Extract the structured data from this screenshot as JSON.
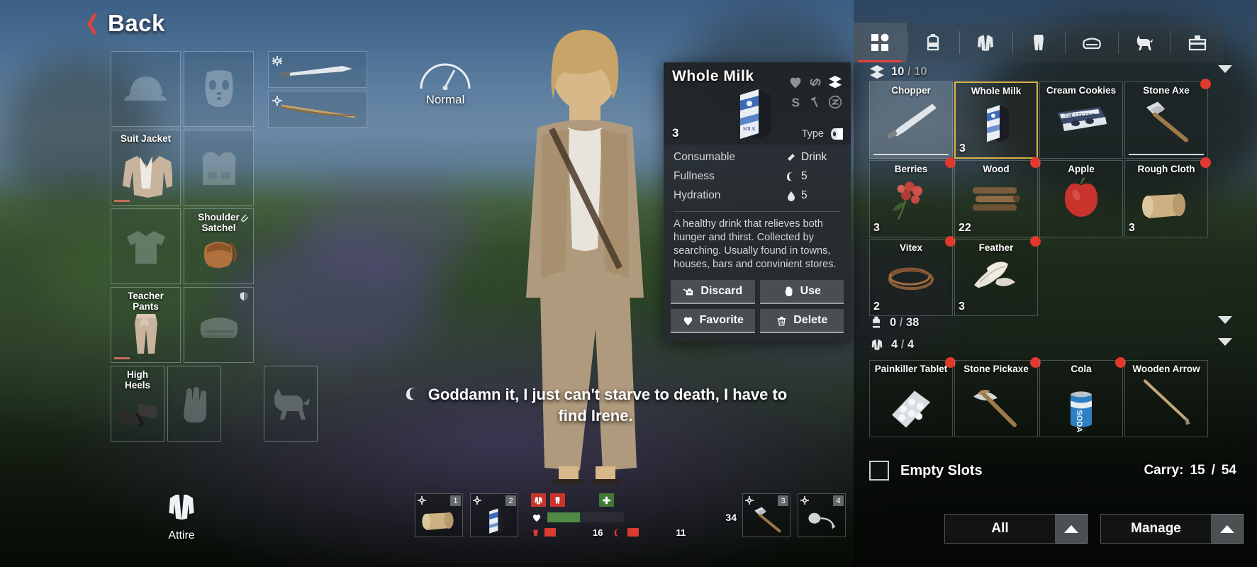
{
  "nav": {
    "back_label": "Back",
    "back_icon": "chevron-left-icon"
  },
  "status": {
    "label": "Normal",
    "icon": "gauge-icon"
  },
  "equipment": {
    "title": "Attire",
    "slots": [
      {
        "name": "",
        "icon": "cap-icon",
        "empty": true,
        "durability": null,
        "badge": null
      },
      {
        "name": "",
        "icon": "mask-icon",
        "empty": true,
        "durability": null,
        "badge": null
      },
      {
        "name": "Suit Jacket",
        "icon": "jacket-icon",
        "empty": false,
        "durability": 30,
        "badge": null
      },
      {
        "name": "",
        "icon": "vest-icon",
        "empty": true,
        "durability": null,
        "badge": null
      },
      {
        "name": "",
        "icon": "tshirt-icon",
        "empty": true,
        "durability": null,
        "badge": null
      },
      {
        "name": "Shoulder Satchel",
        "icon": "satchel-icon",
        "empty": false,
        "durability": null,
        "badge": "attachment-icon"
      },
      {
        "name": "Teacher Pants",
        "icon": "pants-icon",
        "empty": false,
        "durability": 30,
        "badge": null
      },
      {
        "name": "",
        "icon": "waistbag-icon",
        "empty": true,
        "durability": null,
        "badge": "shield-icon"
      },
      {
        "name": "High Heels",
        "icon": "heels-icon",
        "empty": false,
        "durability": null,
        "badge": null
      },
      {
        "name": "",
        "icon": "glove-icon",
        "empty": true,
        "durability": null,
        "badge": null
      },
      {
        "name": "",
        "icon": "dog-icon",
        "empty": true,
        "durability": null,
        "badge": null
      }
    ]
  },
  "weapons": [
    {
      "name": "machete",
      "icon": "machete-icon",
      "gear_icon": "gear-icon"
    },
    {
      "name": "bow",
      "icon": "bow-icon",
      "gear_icon": "gear-icon"
    }
  ],
  "detail": {
    "title": "Whole Milk",
    "quantity": "3",
    "thumb_icon": "milk-carton-icon",
    "flags": [
      {
        "name": "favorite-flag-icon",
        "active": false
      },
      {
        "name": "link-flag-icon",
        "active": false
      },
      {
        "name": "box-flag-icon",
        "active": true
      },
      {
        "name": "sell-flag-icon",
        "active": false
      },
      {
        "name": "craft-flag-icon",
        "active": false
      },
      {
        "name": "nodrop-flag-icon",
        "active": false
      }
    ],
    "type_label": "Type",
    "type_icon": "paper-roll-icon",
    "stats": [
      {
        "label": "Consumable",
        "icon": "drink-icon",
        "value": "Drink"
      },
      {
        "label": "Fullness",
        "icon": "stomach-icon",
        "value": "5"
      },
      {
        "label": "Hydration",
        "icon": "droplet-icon",
        "value": "5"
      }
    ],
    "description": "A healthy drink that relieves both hunger and thirst.\nCollected by searching. Usually found in towns, houses, bars and convinient stores.",
    "actions": [
      {
        "label": "Discard",
        "icon": "discard-icon"
      },
      {
        "label": "Use",
        "icon": "hand-icon"
      },
      {
        "label": "Favorite",
        "icon": "heart-icon"
      },
      {
        "label": "Delete",
        "icon": "trash-icon"
      }
    ]
  },
  "tabs": [
    {
      "name": "tab-all",
      "icon": "grid-icon",
      "active": true
    },
    {
      "name": "tab-backpack",
      "icon": "backpack-icon",
      "active": false
    },
    {
      "name": "tab-jacket",
      "icon": "jacket-icon",
      "active": false
    },
    {
      "name": "tab-pants",
      "icon": "pants-icon",
      "active": false
    },
    {
      "name": "tab-waistbag",
      "icon": "waistbag-icon",
      "active": false
    },
    {
      "name": "tab-pet",
      "icon": "dog-icon",
      "active": false
    },
    {
      "name": "tab-toolbox",
      "icon": "toolbox-icon",
      "active": false
    }
  ],
  "sections": [
    {
      "icon": "box-icon",
      "current": "10",
      "sep": "/",
      "max": "10"
    },
    {
      "icon": "backpack-icon",
      "current": "0",
      "sep": "/",
      "max": "38"
    },
    {
      "icon": "jacket-icon",
      "current": "4",
      "sep": "/",
      "max": "4"
    }
  ],
  "inventory": {
    "rows": [
      [
        {
          "name": "Chopper",
          "icon": "machete-icon",
          "qty": "",
          "dot": false,
          "selected": false,
          "highlight": true,
          "bar": true
        },
        {
          "name": "Whole Milk",
          "icon": "milk-carton-icon",
          "qty": "3",
          "dot": false,
          "selected": true,
          "highlight": false,
          "bar": false
        },
        {
          "name": "Cream Cookies",
          "icon": "cookies-icon",
          "qty": "",
          "dot": false,
          "selected": false,
          "highlight": false,
          "bar": false
        },
        {
          "name": "Stone Axe",
          "icon": "stone-axe-icon",
          "qty": "",
          "dot": true,
          "selected": false,
          "highlight": false,
          "bar": true
        }
      ],
      [
        {
          "name": "Berries",
          "icon": "berries-icon",
          "qty": "3",
          "dot": true,
          "selected": false,
          "highlight": false,
          "bar": false
        },
        {
          "name": "Wood",
          "icon": "wood-icon",
          "qty": "22",
          "dot": true,
          "selected": false,
          "highlight": false,
          "bar": false
        },
        {
          "name": "Apple",
          "icon": "apple-icon",
          "qty": "",
          "dot": false,
          "selected": false,
          "highlight": false,
          "bar": false
        },
        {
          "name": "Rough Cloth",
          "icon": "cloth-icon",
          "qty": "3",
          "dot": true,
          "selected": false,
          "highlight": false,
          "bar": false
        }
      ],
      [
        {
          "name": "Vitex",
          "icon": "vitex-icon",
          "qty": "2",
          "dot": true,
          "selected": false,
          "highlight": false,
          "bar": false
        },
        {
          "name": "Feather",
          "icon": "feather-icon",
          "qty": "3",
          "dot": true,
          "selected": false,
          "highlight": false,
          "bar": false
        }
      ],
      [
        {
          "name": "Painkiller Tablet",
          "icon": "pills-icon",
          "qty": "",
          "dot": true,
          "selected": false,
          "highlight": false,
          "bar": false
        },
        {
          "name": "Stone Pickaxe",
          "icon": "pickaxe-icon",
          "qty": "",
          "dot": true,
          "selected": false,
          "highlight": false,
          "bar": false
        },
        {
          "name": "Cola",
          "icon": "cola-can-icon",
          "qty": "",
          "dot": true,
          "selected": false,
          "highlight": false,
          "bar": false
        },
        {
          "name": "Wooden Arrow",
          "icon": "arrow-icon",
          "qty": "",
          "dot": false,
          "selected": false,
          "highlight": false,
          "bar": false
        }
      ]
    ]
  },
  "footer": {
    "empty_slots_label": "Empty Slots",
    "carry_label": "Carry:",
    "carry_current": "15",
    "carry_sep": "/",
    "carry_max": "54",
    "buttons": [
      {
        "label": "All",
        "caret": "caret-up-icon"
      },
      {
        "label": "Manage",
        "caret": "caret-up-icon"
      }
    ]
  },
  "subtitle": {
    "icon": "stomach-icon",
    "text": "Goddamn it, I just can't starve to death, I have to find Irene."
  },
  "hotbar": {
    "slots": [
      {
        "num": "1",
        "icon": "cloth-icon"
      },
      {
        "num": "2",
        "icon": "milk-carton-icon"
      },
      {
        "num": "3",
        "icon": "stone-axe-icon"
      },
      {
        "num": "4",
        "icon": "slingshot-icon"
      }
    ],
    "vitals": {
      "icons": [
        "shirt-status-icon",
        "pants-status-icon",
        "medkit-status-icon"
      ],
      "health_value": "34",
      "health_pct": 43,
      "thirst_value": "16",
      "hunger_value": "11"
    }
  },
  "colors": {
    "accent_red": "#e0433c",
    "selection_gold": "#d8b24a",
    "health_green": "#4f8a45",
    "warning_red": "#d93b30"
  }
}
